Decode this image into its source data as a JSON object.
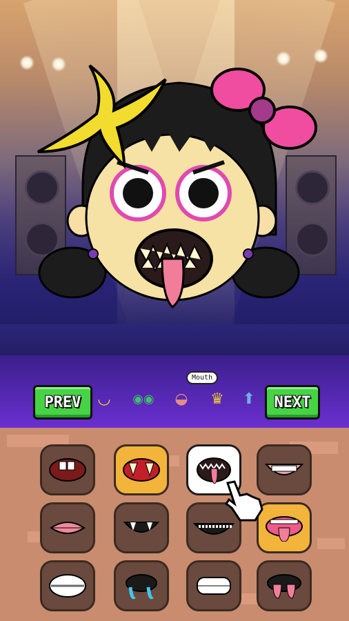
{
  "game": {
    "nav": {
      "prev_label": "PREV",
      "next_label": "NEXT"
    },
    "categories": [
      {
        "name": "face-icon",
        "glyph": "◡",
        "color": "#f6d24a"
      },
      {
        "name": "eyes-icon",
        "glyph": "◉◉",
        "color": "#3fbf6a"
      },
      {
        "name": "mouth-icon",
        "glyph": "👄",
        "color": "#e88a8a"
      },
      {
        "name": "crown-icon",
        "glyph": "♛",
        "color": "#e9c43b"
      },
      {
        "name": "body-icon",
        "glyph": "⬆",
        "color": "#6fb0e6"
      }
    ],
    "selected_category": "Mouth",
    "tooltip": "Mouth",
    "mouth_options": [
      {
        "name": "mouth-buck-teeth",
        "selected": false
      },
      {
        "name": "mouth-fangs-gold",
        "selected": false
      },
      {
        "name": "mouth-shark-tongue",
        "selected": true
      },
      {
        "name": "mouth-wide-grin",
        "selected": false
      },
      {
        "name": "mouth-pink-lips",
        "selected": false
      },
      {
        "name": "mouth-vampire",
        "selected": false
      },
      {
        "name": "mouth-creepy-smile",
        "selected": false
      },
      {
        "name": "mouth-tongue-out",
        "selected": false
      },
      {
        "name": "mouth-braces",
        "selected": false
      },
      {
        "name": "mouth-drool",
        "selected": false
      },
      {
        "name": "mouth-grit-teeth",
        "selected": false
      },
      {
        "name": "mouth-double-tongue",
        "selected": false
      }
    ]
  }
}
